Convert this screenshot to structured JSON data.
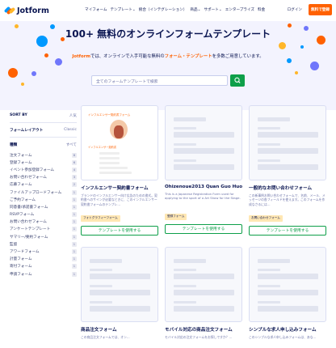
{
  "header": {
    "brand": "Jotform",
    "nav": [
      "マイフォーム",
      "テンプレート",
      "統合（インテグレーション）",
      "商品",
      "サポート",
      "エンタープライズ",
      "料金"
    ],
    "login": "ログイン",
    "signup": "無料で登録"
  },
  "hero": {
    "title": "100+ 無料のオンラインフォームテンプレート",
    "subtitle_brand": "Jotform",
    "subtitle_pre": "では、オンラインで入手可能な無料の",
    "subtitle_highlight": "フォーム・テンプレート",
    "subtitle_post": "を多数ご用意しています。",
    "search_placeholder": "全てのフォームテンプレートで検索"
  },
  "sidebar": {
    "sort_label": "SORT BY",
    "sort_value": "人気",
    "layout_label": "フォームレイアウト",
    "layout_value": "Classic",
    "cat_label": "種類",
    "cat_value": "すべて",
    "categories": [
      {
        "label": "注文フォーム",
        "count": "8"
      },
      {
        "label": "登録フォーム",
        "count": "6"
      },
      {
        "label": "イベント参加登録フォーム",
        "count": "4"
      },
      {
        "label": "お問い合わせフォーム",
        "count": "3"
      },
      {
        "label": "応募フォーム",
        "count": "2"
      },
      {
        "label": "ファイルアップロードフォーム",
        "count": "1"
      },
      {
        "label": "ご予約フォーム",
        "count": "1"
      },
      {
        "label": "同意書/承諾書フォーム",
        "count": "1"
      },
      {
        "label": "RSVPフォーム",
        "count": "1"
      },
      {
        "label": "お問い合わせフォーム",
        "count": "1"
      },
      {
        "label": "アンケートテンプレート",
        "count": "1"
      },
      {
        "label": "サマリー/要約フォーム",
        "count": "1"
      },
      {
        "label": "監督",
        "count": "1"
      },
      {
        "label": "アワードフォーム",
        "count": "1"
      },
      {
        "label": "計量フォーム",
        "count": "1"
      },
      {
        "label": "寄付フォーム",
        "count": "1"
      },
      {
        "label": "申請フォーム",
        "count": "1"
      }
    ]
  },
  "cards": [
    {
      "title": "インフルエンサー契約書フォーム",
      "desc": "ブランドのインフルエンサー向け広告のための書式。契約書へのサインが必要なときに、このインフルエンサー契約書フォームのテンプレ…",
      "tag": "フォトグラフィーフォーム",
      "tag_color": "#ffe7b3",
      "button": "テンプレートを使用する",
      "preview_title": "インフルエンサー契約書フォーム",
      "preview_sub": "インフルエンサー契約書"
    },
    {
      "title": "Ohizenoue2013 Quan Guo Huora…",
      "desc": "This is a Japanese Registration Form used for applying to the sport of a Art Show for the Stage.",
      "tag": "登録フォーム",
      "tag_color": "#ffe7b3",
      "button": "テンプレートを使用する"
    },
    {
      "title": "一般的なお問い合わせフォーム",
      "desc": "この新事例お問い合わせフォームで、名前、メール、メッセージの各フィールドを使えます。このフォームを作成なさるには…",
      "tag": "お問い合わせフォーム",
      "tag_color": "#ffe7b3",
      "button": "テンプレートを使用する"
    },
    {
      "title": "商品注文フォーム",
      "desc": "この商品注文フォームでは、オン…",
      "button": ""
    },
    {
      "title": "モバイル対応の商品注文フォーム",
      "desc": "モバイル対応の注文フォームをお探しですか？…",
      "button": ""
    },
    {
      "title": "シンプルな求人申し込みフォーム",
      "desc": "このシンプルな求人申し込みフォームは、あな…",
      "button": ""
    }
  ]
}
